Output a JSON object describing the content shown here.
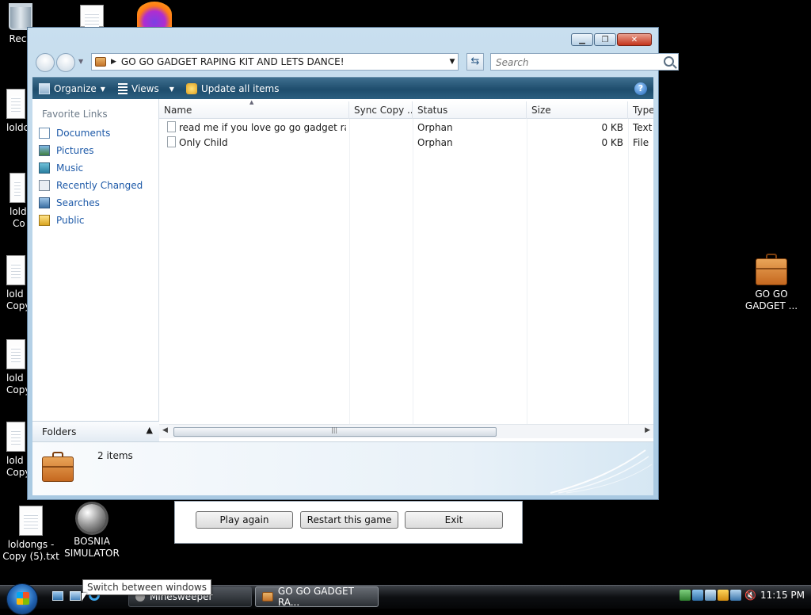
{
  "desktop": {
    "recycle_label": "Recy",
    "partial_labels": [
      {
        "line1": "loldc",
        "line2": ""
      },
      {
        "line1": "lold",
        "line2": "Co"
      },
      {
        "line1": "lold",
        "line2": "Copy"
      },
      {
        "line1": "lold",
        "line2": "Copy"
      },
      {
        "line1": "lold",
        "line2": "Copy"
      }
    ],
    "txt_icon_label": "loldongs - Copy (5).txt",
    "bosnia_label": "BOSNIA SIMULATOR",
    "briefcase_label": "GO GO GADGET ..."
  },
  "explorer": {
    "address_text": "GO GO GADGET RAPING KIT AND LETS DANCE!",
    "search_placeholder": "Search",
    "toolbar": {
      "organize": "Organize",
      "views": "Views",
      "update": "Update all items"
    },
    "nav": {
      "title": "Favorite Links",
      "items": [
        "Documents",
        "Pictures",
        "Music",
        "Recently Changed",
        "Searches",
        "Public"
      ],
      "folders_label": "Folders"
    },
    "columns": [
      "Name",
      "Sync Copy ...",
      "Status",
      "Size",
      "Type"
    ],
    "rows": [
      {
        "name": "read me if you love go go gadget rapi...",
        "sync": "",
        "status": "Orphan",
        "size": "0 KB",
        "type": "Text"
      },
      {
        "name": "Only Child",
        "sync": "",
        "status": "Orphan",
        "size": "0 KB",
        "type": "File"
      }
    ],
    "details_count": "2 items"
  },
  "minesweeper": {
    "play_again": "Play again",
    "restart": "Restart this game",
    "exit": "Exit"
  },
  "taskbar": {
    "tooltip": "Switch between windows",
    "tasks": [
      "Minesweeper",
      "GO GO GADGET RA..."
    ],
    "clock": "11:15 PM"
  },
  "colors": {
    "toolbar": "#1e4d6d",
    "link": "#1e5aa8",
    "desktop": "#000000"
  }
}
